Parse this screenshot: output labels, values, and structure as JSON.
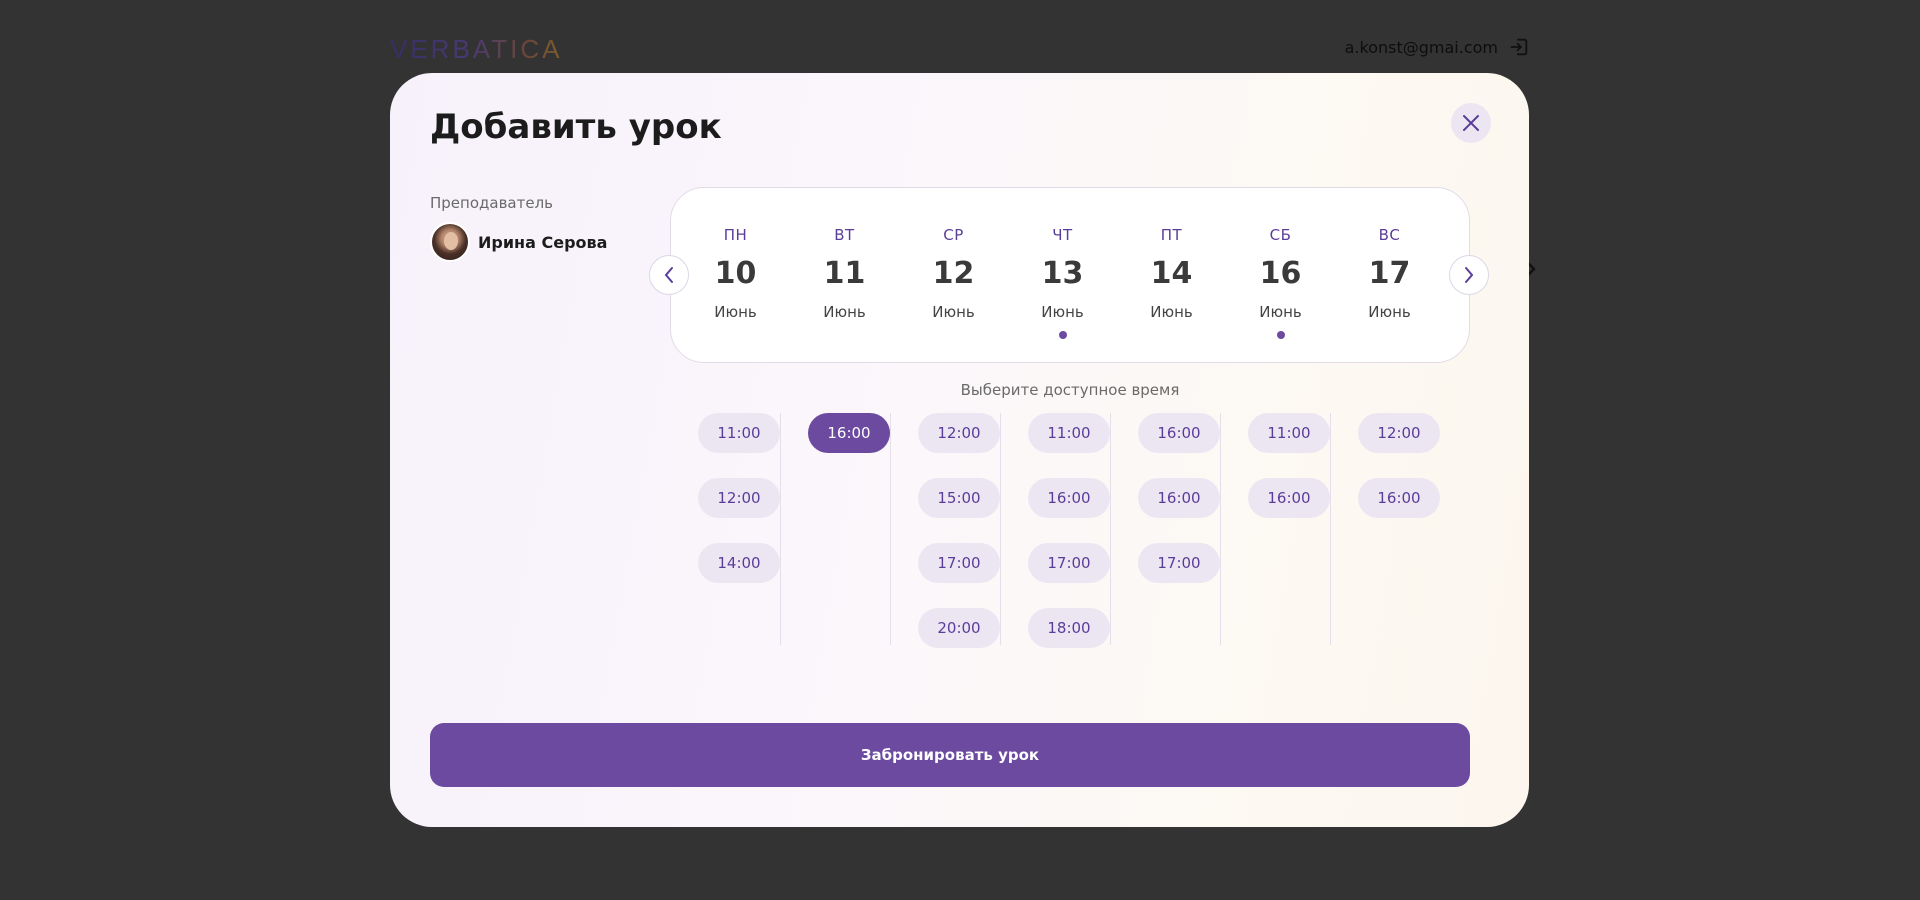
{
  "header": {
    "logo_text": "VERBATICA",
    "email": "a.konst@gmai.com",
    "logout_icon": "logout-icon"
  },
  "modal": {
    "title": "Добавить урок",
    "close_icon": "close-icon",
    "teacher_label": "Преподаватель",
    "teacher_name": "Ирина Серова",
    "days": [
      {
        "dow": "ПН",
        "num": "10",
        "month": "Июнь",
        "has_dot": false
      },
      {
        "dow": "ВТ",
        "num": "11",
        "month": "Июнь",
        "has_dot": false
      },
      {
        "dow": "СР",
        "num": "12",
        "month": "Июнь",
        "has_dot": false
      },
      {
        "dow": "ЧТ",
        "num": "13",
        "month": "Июнь",
        "has_dot": true
      },
      {
        "dow": "ПТ",
        "num": "14",
        "month": "Июнь",
        "has_dot": false
      },
      {
        "dow": "СБ",
        "num": "16",
        "month": "Июнь",
        "has_dot": true
      },
      {
        "dow": "ВС",
        "num": "17",
        "month": "Июнь",
        "has_dot": false
      }
    ],
    "time_hint": "Выберите доступное время",
    "slots": [
      [
        "11:00",
        "12:00",
        "14:00"
      ],
      [
        "16:00"
      ],
      [
        "12:00",
        "15:00",
        "17:00",
        "20:00"
      ],
      [
        "11:00",
        "16:00",
        "17:00",
        "18:00"
      ],
      [
        "16:00",
        "16:00",
        "17:00"
      ],
      [
        "11:00",
        "16:00"
      ],
      [
        "12:00",
        "16:00"
      ]
    ],
    "selected_slot": {
      "day": 1,
      "index": 0
    },
    "book_button": "Забронировать урок"
  },
  "colors": {
    "accent": "#6b4aa0",
    "slot_bg": "#ece6f2",
    "overlay": "#333333"
  }
}
